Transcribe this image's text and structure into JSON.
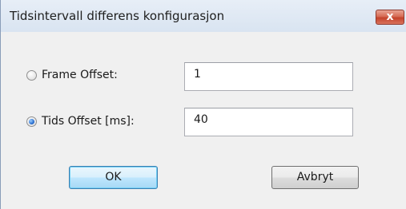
{
  "window": {
    "title": "Tidsintervall differens konfigurasjon",
    "close_glyph": "x"
  },
  "options": [
    {
      "label": "Frame Offset:",
      "value": "1",
      "selected": false
    },
    {
      "label": "Tids Offset [ms]:",
      "value": "40",
      "selected": true
    }
  ],
  "buttons": {
    "ok_label": "OK",
    "cancel_label": "Avbryt"
  }
}
